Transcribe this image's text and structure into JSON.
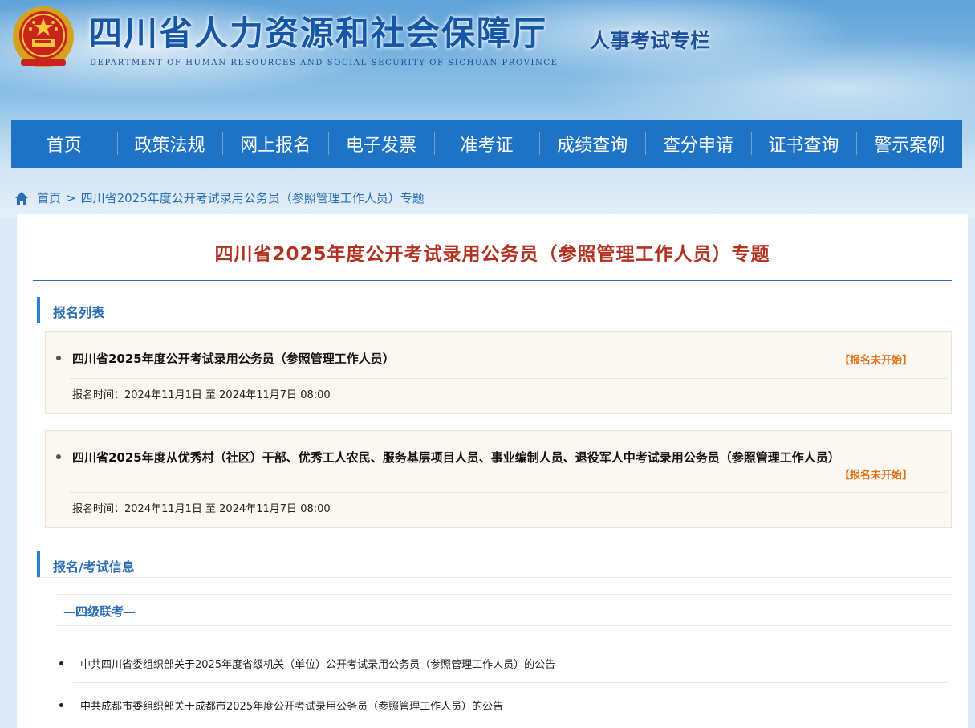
{
  "header": {
    "title": "四川省人力资源和社会保障厅",
    "subtitle": "DEPARTMENT OF HUMAN RESOURCES AND SOCIAL SECURITY OF SICHUAN PROVINCE",
    "column": "人事考试专栏"
  },
  "nav": {
    "items": [
      "首页",
      "政策法规",
      "网上报名",
      "电子发票",
      "准考证",
      "成绩查询",
      "查分申请",
      "证书查询",
      "警示案例"
    ]
  },
  "breadcrumb": {
    "home": "首页",
    "separator": ">",
    "current": "四川省2025年度公开考试录用公务员（参照管理工作人员）专题"
  },
  "main": {
    "title": "四川省2025年度公开考试录用公务员（参照管理工作人员）专题",
    "registration_section": "报名列表",
    "registrations": [
      {
        "name": "四川省2025年度公开考试录用公务员（参照管理工作人员）",
        "status": "【报名未开始】",
        "time": "报名时间：2024年11月1日 至 2024年11月7日 08:00"
      },
      {
        "name": "四川省2025年度从优秀村（社区）干部、优秀工人农民、服务基层项目人员、事业编制人员、退役军人中考试录用公务员（参照管理工作人员）",
        "status": "【报名未开始】",
        "time": "报名时间：2024年11月1日 至 2024年11月7日 08:00"
      }
    ],
    "info_section": "报名/考试信息",
    "subsection": "—四级联考—",
    "notices": [
      "中共四川省委组织部关于2025年度省级机关（单位）公开考试录用公务员（参照管理工作人员）的公告",
      "中共成都市委组织部关于成都市2025年度公开考试录用公务员（参照管理工作人员）的公告"
    ]
  },
  "colors": {
    "nav_bg": "#1e73c4",
    "title_red": "#b23222",
    "status_orange": "#e36f16",
    "link_blue": "#2a6db4"
  },
  "icons": {
    "emblem": "national-emblem-icon",
    "home": "home-icon",
    "bullet": "bullet-dot-icon"
  }
}
